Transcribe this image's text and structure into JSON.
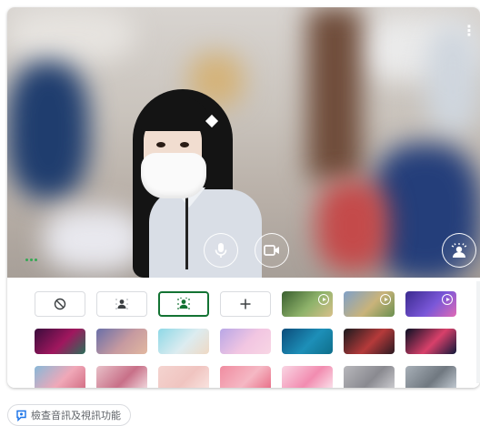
{
  "preview": {
    "more_icon": "more-vert-icon",
    "controls": [
      {
        "name": "mic",
        "icon": "microphone-icon"
      },
      {
        "name": "camera",
        "icon": "camera-icon"
      },
      {
        "name": "effects",
        "icon": "visual-effects-icon"
      }
    ]
  },
  "effects": {
    "options": [
      {
        "icon": "none-icon"
      },
      {
        "icon": "slight-blur-icon"
      },
      {
        "icon": "blur-icon",
        "selected": true
      },
      {
        "icon": "add-image-icon"
      }
    ],
    "backgrounds_row1": [
      {
        "name": "animated-garden",
        "colors": [
          "#3a5f2f",
          "#8fb36b",
          "#d8c08a"
        ],
        "animated": true
      },
      {
        "name": "animated-classroom",
        "colors": [
          "#7fa0c8",
          "#c9b37a",
          "#6a8f4f"
        ],
        "animated": true
      },
      {
        "name": "animated-purple-room",
        "colors": [
          "#3b2a8f",
          "#7a57d8",
          "#e06ab5"
        ],
        "animated": true
      }
    ],
    "backgrounds_row2": [
      {
        "name": "pink-lights",
        "colors": [
          "#3a0c3c",
          "#a0175e",
          "#2a6f5a"
        ]
      },
      {
        "name": "dusk-sky",
        "colors": [
          "#6a6fa8",
          "#c69aa0",
          "#e2b8a0"
        ]
      },
      {
        "name": "beach",
        "colors": [
          "#8ed8e6",
          "#dcecf0",
          "#efd9c4"
        ]
      },
      {
        "name": "pastel-clouds",
        "colors": [
          "#b8a6e6",
          "#f2c6e2",
          "#f8d6e4"
        ]
      },
      {
        "name": "underwater",
        "colors": [
          "#0c4c7a",
          "#1d8fb8",
          "#0e6e8a"
        ]
      },
      {
        "name": "red-smoke",
        "colors": [
          "#1a1a1e",
          "#b53a3a",
          "#2a1a22"
        ]
      },
      {
        "name": "fireworks",
        "colors": [
          "#0a1024",
          "#d8406a",
          "#10183a"
        ]
      }
    ],
    "backgrounds_row3": [
      {
        "name": "cherry-blossom-sky",
        "colors": [
          "#88b8d8",
          "#f0a8b8",
          "#d06a80"
        ]
      },
      {
        "name": "floral-pattern",
        "colors": [
          "#e8c0c8",
          "#c87088",
          "#f4e0e4"
        ]
      },
      {
        "name": "pale-pink",
        "colors": [
          "#f4d4d0",
          "#f0c4c0",
          "#fae6e2"
        ]
      },
      {
        "name": "polka-dot-pink",
        "colors": [
          "#f08ca0",
          "#f5b8c4",
          "#e86a84"
        ]
      },
      {
        "name": "sakura",
        "colors": [
          "#f9d6e4",
          "#f28cb0",
          "#fbe8f0"
        ]
      },
      {
        "name": "city-rooftop",
        "colors": [
          "#b8b8bc",
          "#8a8a90",
          "#d0d0d4"
        ]
      },
      {
        "name": "office-window",
        "colors": [
          "#a8b0b8",
          "#707880",
          "#c8d0d8"
        ]
      }
    ]
  },
  "footer": {
    "check_label": "檢查音訊及視訊功能",
    "check_icon": "check-av-icon"
  }
}
